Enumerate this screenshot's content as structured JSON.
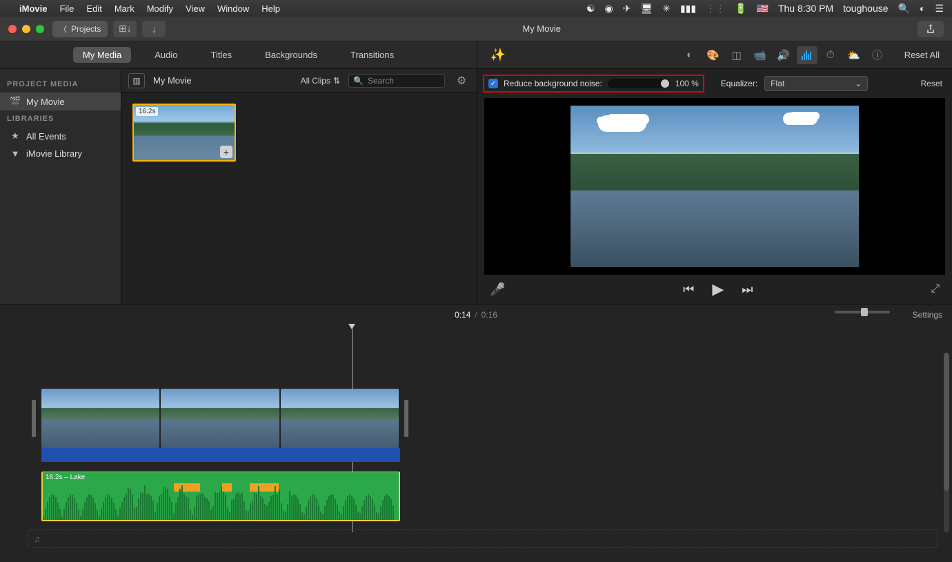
{
  "menubar": {
    "app_name": "iMovie",
    "menus": [
      "File",
      "Edit",
      "Mark",
      "Modify",
      "View",
      "Window",
      "Help"
    ],
    "clock": "Thu 8:30 PM",
    "user": "toughouse"
  },
  "titlebar": {
    "back_label": "Projects",
    "window_title": "My Movie"
  },
  "tabs": {
    "items": [
      "My Media",
      "Audio",
      "Titles",
      "Backgrounds",
      "Transitions"
    ],
    "active_index": 0
  },
  "inspector": {
    "reset_all": "Reset All"
  },
  "sidebar": {
    "section_project": "PROJECT MEDIA",
    "project_item": "My Movie",
    "section_lib": "LIBRARIES",
    "all_events": "All Events",
    "library": "iMovie Library"
  },
  "media_header": {
    "title": "My Movie",
    "filter": "All Clips",
    "search_placeholder": "Search"
  },
  "clip": {
    "duration": "16.2s"
  },
  "noise": {
    "label": "Reduce background noise:",
    "value": "100 %"
  },
  "equalizer": {
    "label": "Equalizer:",
    "value": "Flat",
    "reset": "Reset"
  },
  "timeline": {
    "current": "0:14",
    "total": "0:16",
    "settings": "Settings",
    "audio_label": "16.2s – Lake"
  }
}
